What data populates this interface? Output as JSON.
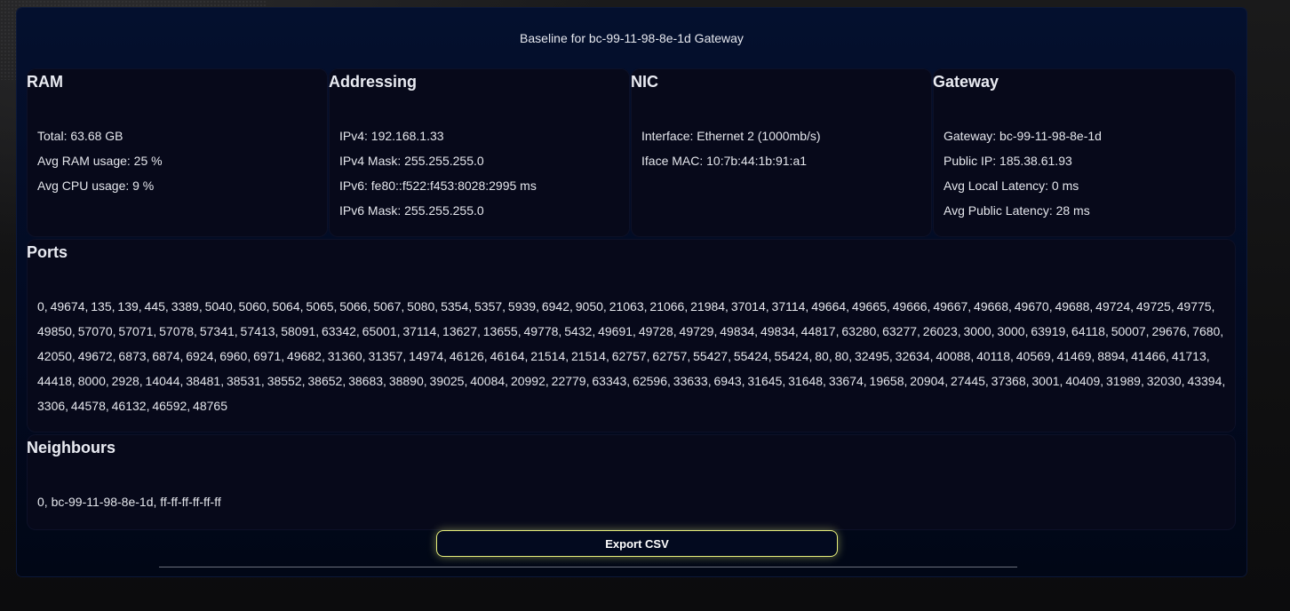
{
  "title": "Baseline for bc-99-11-98-8e-1d Gateway",
  "ram": {
    "heading": "RAM",
    "lines": [
      "Total: 63.68 GB",
      "Avg RAM usage: 25 %",
      "Avg CPU usage: 9 %"
    ]
  },
  "addressing": {
    "heading": "Addressing",
    "lines": [
      "IPv4: 192.168.1.33",
      "IPv4 Mask: 255.255.255.0",
      "IPv6: fe80::f522:f453:8028:2995 ms",
      "IPv6 Mask: 255.255.255.0"
    ]
  },
  "nic": {
    "heading": "NIC",
    "lines": [
      "Interface: Ethernet 2 (1000mb/s)",
      "Iface MAC: 10:7b:44:1b:91:a1"
    ]
  },
  "gateway": {
    "heading": "Gateway",
    "lines": [
      "Gateway: bc-99-11-98-8e-1d",
      "Public IP: 185.38.61.93",
      "Avg Local Latency: 0 ms",
      "Avg Public Latency: 28 ms"
    ]
  },
  "ports": {
    "heading": "Ports",
    "text": "0, 49674, 135, 139, 445, 3389, 5040, 5060, 5064, 5065, 5066, 5067, 5080, 5354, 5357, 5939, 6942, 9050, 21063, 21066, 21984, 37014, 37114, 49664, 49665, 49666, 49667, 49668, 49670, 49688, 49724, 49725, 49775, 49850, 57070, 57071, 57078, 57341, 57413, 58091, 63342, 65001, 37114, 13627, 13655, 49778, 5432, 49691, 49728, 49729, 49834, 49834, 44817, 63280, 63277, 26023, 3000, 3000, 63919, 64118, 50007, 29676, 7680, 42050, 49672, 6873, 6874, 6924, 6960, 6971, 49682, 31360, 31357, 14974, 46126, 46164, 21514, 21514, 62757, 62757, 55427, 55424, 55424, 80, 80, 32495, 32634, 40088, 40118, 40569, 41469, 8894, 41466, 41713, 44418, 8000, 2928, 14044, 38481, 38531, 38552, 38652, 38683, 38890, 39025, 40084, 20992, 22779, 63343, 62596, 33633, 6943, 31645, 31648, 33674, 19658, 20904, 27445, 37368, 3001, 40409, 31989, 32030, 43394, 3306, 44578, 46132, 46592, 48765"
  },
  "neighbours": {
    "heading": "Neighbours",
    "text": "0, bc-99-11-98-8e-1d, ff-ff-ff-ff-ff-ff"
  },
  "export_label": "Export CSV",
  "colors": {
    "panel_bg": "#020a22",
    "card_bg": "#07091a",
    "button_border": "#e6ee7a"
  }
}
